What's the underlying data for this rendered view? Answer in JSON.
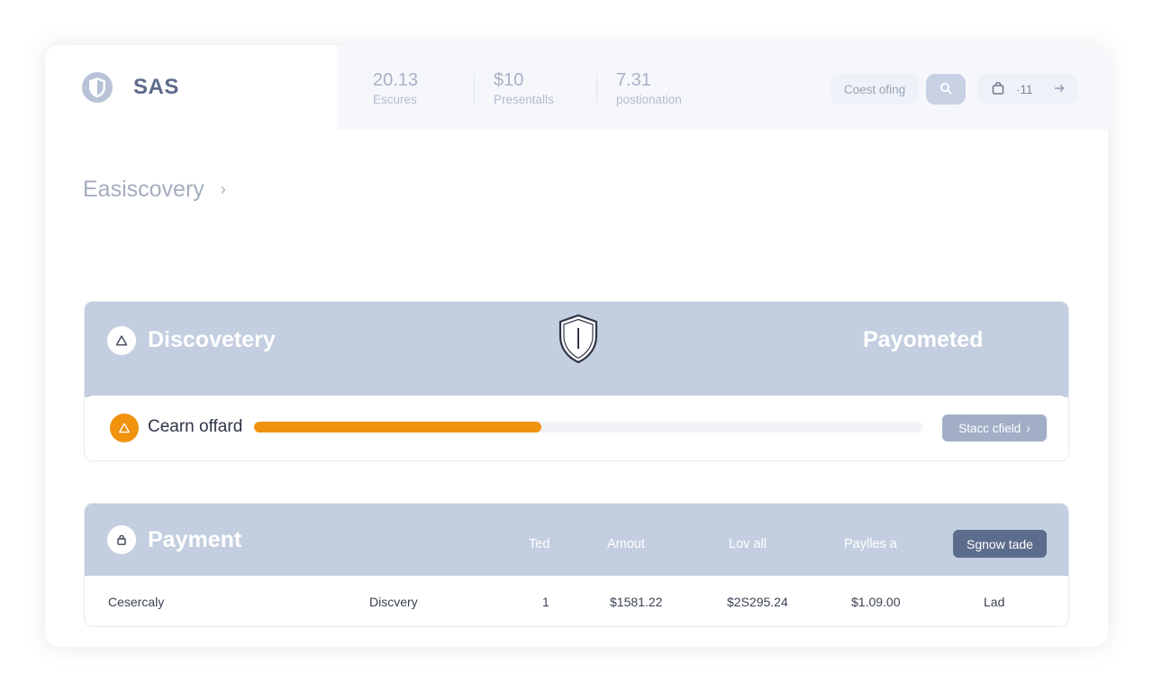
{
  "brand": {
    "name": "SAS",
    "logo_icon": "shield-icon"
  },
  "stats": [
    {
      "value": "20.13",
      "label": "Escures"
    },
    {
      "value": "$10",
      "label": "Presentalls"
    },
    {
      "value": "7.31",
      "label": "postionation"
    }
  ],
  "toolbar": {
    "filter_label": "Coest ofing",
    "search_icon": "search-icon",
    "notify_icon": "bag-icon",
    "notify_count": "·11",
    "arrow_icon": "arrow-right-icon"
  },
  "breadcrumb": {
    "label": "Easiscovery",
    "chevron": "›"
  },
  "discovery": {
    "title": "Discovetery",
    "right_title": "Payometed",
    "center_icon": "shield-icon",
    "item_label": "Cearn offard",
    "progress": 0.43,
    "action_label": "Stacc cfield",
    "action_chevron": "›",
    "colors": {
      "header": "#c3cee0",
      "progress": "#f0920e",
      "button": "#a1aec6"
    }
  },
  "payment": {
    "title": "Payment",
    "columns": [
      "Ted",
      "Amout",
      "Lov all",
      "Paylles a"
    ],
    "button_label": "Sgnow tade",
    "row": [
      "Cesercaly",
      "Discvery",
      "1",
      "$1581.22",
      "$2S295.24",
      "$1.09.00",
      "Lad"
    ],
    "colors": {
      "button": "#5c6c8c"
    }
  }
}
